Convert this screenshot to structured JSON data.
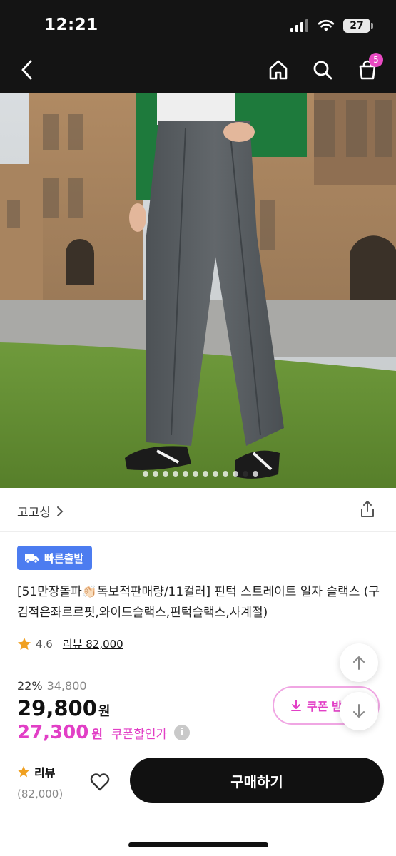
{
  "status_bar": {
    "time": "12:21",
    "battery": "27"
  },
  "nav": {
    "cart_count": "5"
  },
  "carousel": {
    "total": 12,
    "active_index": 10
  },
  "store": {
    "name": "고고싱"
  },
  "product": {
    "badge": "빠른출발",
    "title": "[51만장돌파👏🏻독보적판매량/11컬러] 핀턱 스트레이트 일자 슬랙스 (구김적은좌르르핏,와이드슬랙스,핀턱슬랙스,사계절)",
    "rating": "4.6",
    "reviews_link": "리뷰 82,000"
  },
  "price": {
    "discount_rate": "22%",
    "original": "34,800",
    "sale": "29,800",
    "unit": "원",
    "coupon_price": "27,300",
    "coupon_label": "쿠폰할인가",
    "info": "i"
  },
  "coupon_button": {
    "label": "쿠폰 받"
  },
  "bottom": {
    "review_label": "리뷰",
    "review_count": "(82,000)",
    "buy_label": "구매하기"
  },
  "colors": {
    "accent_pink": "#e23fc6",
    "badge_blue": "#4c7cf0",
    "star": "#f0a020"
  }
}
